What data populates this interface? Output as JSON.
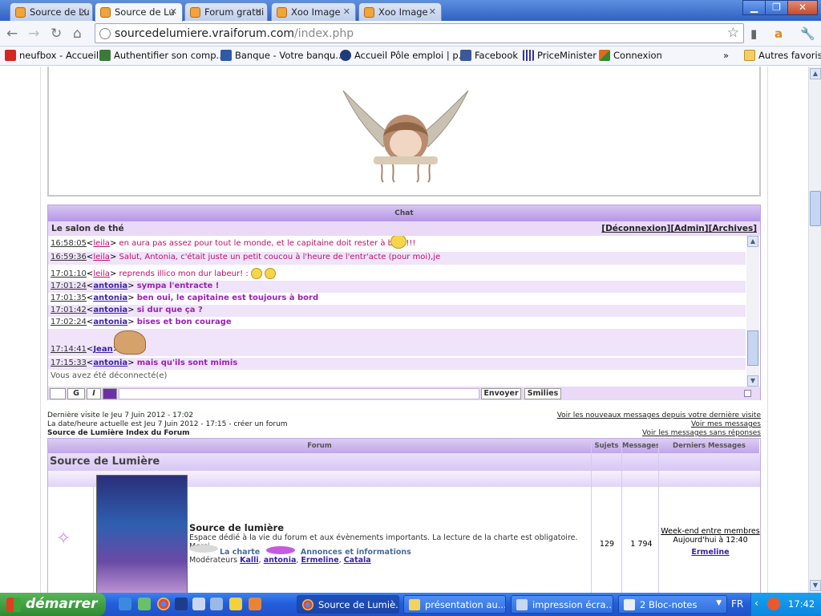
{
  "browser": {
    "tabs": [
      {
        "label": "Source de Lu",
        "active": false
      },
      {
        "label": "Source de Lu",
        "active": true
      },
      {
        "label": "Forum gratui",
        "active": false
      },
      {
        "label": "Xoo Image",
        "active": false
      },
      {
        "label": "Xoo Image",
        "active": false
      }
    ],
    "url_host": "sourcedelumiere.vraiforum.com",
    "url_path": "/index.php",
    "bookmarks": [
      {
        "label": "neufbox - Accueil",
        "color": "#d3271f"
      },
      {
        "label": "Authentifier son comp...",
        "color": "#3d7a3a"
      },
      {
        "label": "Banque - Votre banqu...",
        "color": "#2f5aa8"
      },
      {
        "label": "Accueil Pôle emploi | p...",
        "color": "#1f3b7a"
      },
      {
        "label": "Facebook",
        "color": "#3b5998"
      },
      {
        "label": "PriceMinister",
        "color": "#333399"
      },
      {
        "label": "Connexion",
        "color": "#e06a1d"
      }
    ],
    "bookmarks_overflow": "»",
    "other_bookmarks": "Autres favoris"
  },
  "chat": {
    "header": "Chat",
    "room": "Le salon de thé",
    "links": [
      "[Déconnexion]",
      "[Admin]",
      "[Archives]"
    ],
    "lines": [
      {
        "time": "16:58:05",
        "user": "leila",
        "msg": "en aura pas assez pour tout le monde, et le capitaine doit rester à bord!!!",
        "style": "m1"
      },
      {
        "time": "16:59:36",
        "user": "leila",
        "msg": "Salut, Antonia, c'était juste un petit coucou à l'heure de l'entr'acte (pour moi),je",
        "style": "m1"
      },
      {
        "time": "17:01:10",
        "user": "leila",
        "msg": "reprends illico mon dur labeur! :",
        "style": "m1"
      },
      {
        "time": "17:01:24",
        "user": "antonia",
        "msg": "sympa l'entracte !",
        "style": "m2"
      },
      {
        "time": "17:01:35",
        "user": "antonia",
        "msg": "ben oui, le capitaine est toujours à bord",
        "style": "m2"
      },
      {
        "time": "17:01:42",
        "user": "antonia",
        "msg": "si dur que ça ?",
        "style": "m2"
      },
      {
        "time": "17:02:24",
        "user": "antonia",
        "msg": "bises et bon courage",
        "style": "m2"
      },
      {
        "time": "17:14:41",
        "user": "Jean",
        "msg": "",
        "style": "m2"
      },
      {
        "time": "17:15:33",
        "user": "antonia",
        "msg": "mais qu'ils sont mimis",
        "style": "m2"
      }
    ],
    "disconnected": "Vous avez été déconnecté(e)",
    "btn_bold": "G",
    "btn_italic": "I",
    "btn_send": "Envoyer",
    "btn_smilies": "Smilies"
  },
  "stats": {
    "last_visit": "Dernière visite le Jeu 7 Juin 2012 - 17:02",
    "now": "La date/heure actuelle est Jeu 7 Juin 2012 - 17:15 - créer un forum",
    "index": "Source de Lumière Index du Forum",
    "right_links": [
      "Voir les nouveaux messages depuis votre dernière visite",
      "Voir mes messages",
      "Voir les messages sans réponses"
    ]
  },
  "forum": {
    "headers": {
      "forum": "Forum",
      "topics": "Sujets",
      "posts": "Messages",
      "last": "Derniers Messages"
    },
    "category": "Source de Lumière",
    "row": {
      "name": "Source de lumière",
      "desc": "Espace dédié à la vie du forum et aux évènements importants. La lecture de la charte est obligatoire. Merci.",
      "sub1": "La charte",
      "sub2": "Annonces et informations",
      "mods_label": "Modérateurs",
      "mods": [
        "Kalli",
        "antonia",
        "Ermeline",
        "Catala"
      ],
      "topics": "129",
      "posts": "1 794",
      "last_title": "Week-end entre membres",
      "last_time": "Aujourd'hui à 12:40",
      "last_user": "Ermeline"
    }
  },
  "taskbar": {
    "start": "démarrer",
    "items": [
      {
        "label": "Source de Lumiè...",
        "active": true
      },
      {
        "label": "présentation au...",
        "active": false
      },
      {
        "label": "impression écra...",
        "active": false
      },
      {
        "label": "2 Bloc-notes",
        "active": false
      }
    ],
    "lang": "FR",
    "clock": "17:42"
  }
}
